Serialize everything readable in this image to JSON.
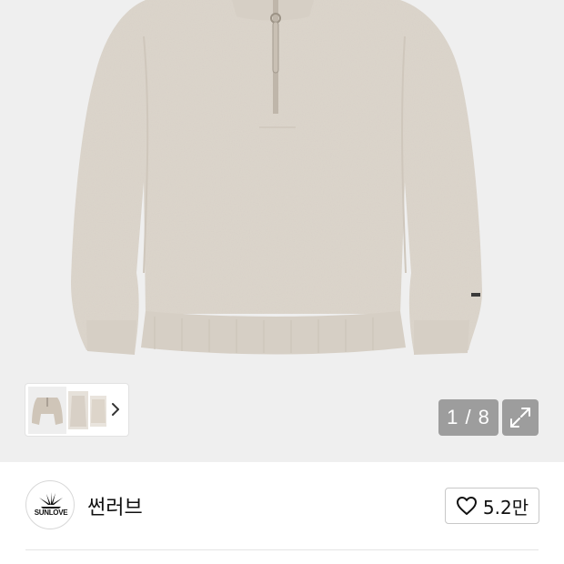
{
  "gallery": {
    "counter": "1 / 8",
    "icons": {
      "next": "chevron-right-icon",
      "expand": "expand-arrows-icon"
    },
    "colors": {
      "background": "#efefef",
      "garment": "#ddd6cc",
      "counter_bg": "#7d7d7d"
    }
  },
  "brand": {
    "logo_text": "SUNLOVE",
    "name": "썬러브",
    "like_icon": "heart-outline-icon",
    "like_count": "5.2만"
  }
}
